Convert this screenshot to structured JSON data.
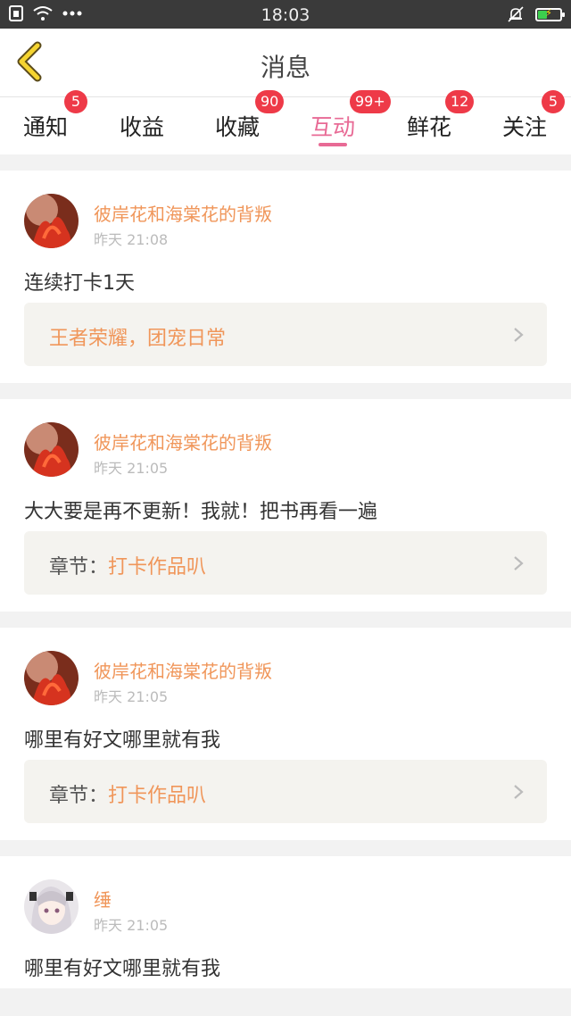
{
  "status_bar": {
    "time": "18:03"
  },
  "header": {
    "title": "消息"
  },
  "tabs": [
    {
      "label": "通知",
      "badge": "5"
    },
    {
      "label": "收益",
      "badge": ""
    },
    {
      "label": "收藏",
      "badge": "90"
    },
    {
      "label": "互动",
      "badge": "99+",
      "active": true
    },
    {
      "label": "鲜花",
      "badge": "12"
    },
    {
      "label": "关注",
      "badge": "5"
    }
  ],
  "colors": {
    "accent_pink": "#e86a95",
    "name_orange": "#f0965a",
    "badge_red": "#ee3a48"
  },
  "messages": [
    {
      "user": "彼岸花和海棠花的背叛",
      "time": "昨天 21:08",
      "content": "连续打卡1天",
      "ref_prefix": "",
      "ref_title": "王者荣耀，团宠日常"
    },
    {
      "user": "彼岸花和海棠花的背叛",
      "time": "昨天 21:05",
      "content": "大大要是再不更新！我就！把书再看一遍",
      "ref_prefix": "章节：",
      "ref_title": "打卡作品叭"
    },
    {
      "user": "彼岸花和海棠花的背叛",
      "time": "昨天 21:05",
      "content": "哪里有好文哪里就有我",
      "ref_prefix": "章节：",
      "ref_title": "打卡作品叭"
    },
    {
      "user": "缍",
      "time": "昨天 21:05",
      "content": "哪里有好文哪里就有我"
    }
  ]
}
